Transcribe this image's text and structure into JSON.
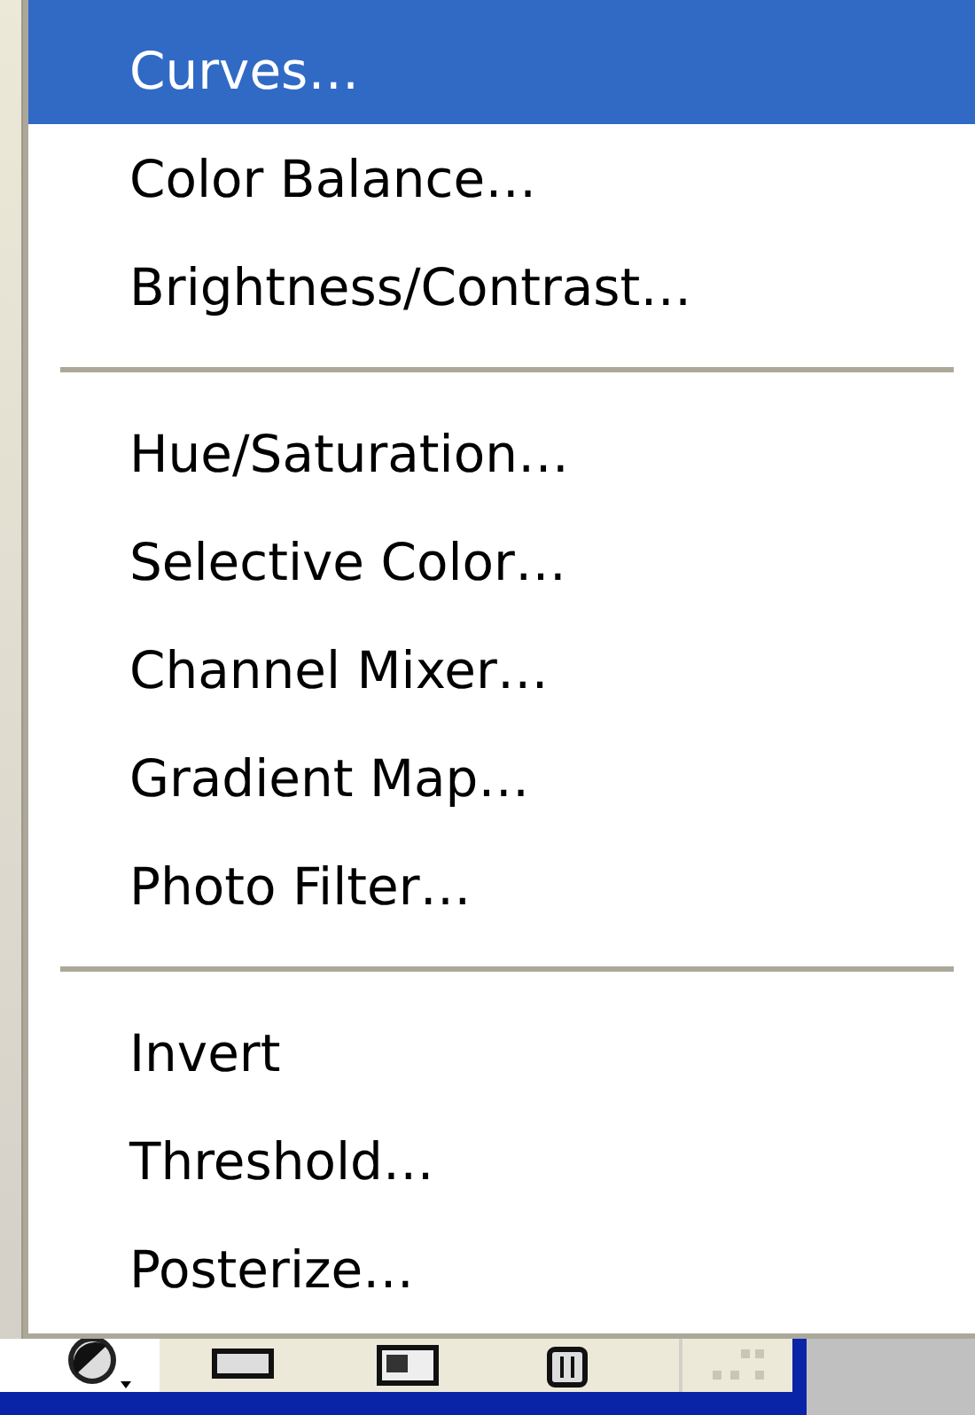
{
  "menu": {
    "groups": [
      {
        "items": [
          {
            "label": "Curves…",
            "selected": true
          },
          {
            "label": "Color Balance…",
            "selected": false
          },
          {
            "label": "Brightness/Contrast…",
            "selected": false
          }
        ]
      },
      {
        "items": [
          {
            "label": "Hue/Saturation…",
            "selected": false
          },
          {
            "label": "Selective Color…",
            "selected": false
          },
          {
            "label": "Channel Mixer…",
            "selected": false
          },
          {
            "label": "Gradient Map…",
            "selected": false
          },
          {
            "label": "Photo Filter…",
            "selected": false
          }
        ]
      },
      {
        "items": [
          {
            "label": "Invert",
            "selected": false
          },
          {
            "label": "Threshold…",
            "selected": false
          },
          {
            "label": "Posterize…",
            "selected": false
          }
        ]
      }
    ]
  }
}
